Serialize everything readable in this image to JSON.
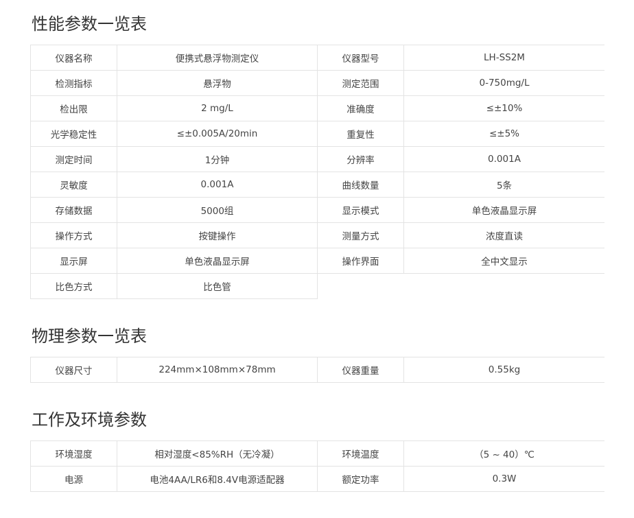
{
  "sections": [
    {
      "title": "性能参数一览表",
      "rows": [
        [
          "仪器名称",
          "便携式悬浮物测定仪",
          "仪器型号",
          "LH-SS2M"
        ],
        [
          "检测指标",
          "悬浮物",
          "测定范围",
          "0-750mg/L"
        ],
        [
          "检出限",
          "2 mg/L",
          "准确度",
          "≤±10%"
        ],
        [
          "光学稳定性",
          "≤±0.005A/20min",
          "重复性",
          "≤±5%"
        ],
        [
          "测定时间",
          "1分钟",
          "分辨率",
          "0.001A"
        ],
        [
          "灵敏度",
          "0.001A",
          "曲线数量",
          "5条"
        ],
        [
          "存储数据",
          "5000组",
          "显示模式",
          "单色液晶显示屏"
        ],
        [
          "操作方式",
          "按键操作",
          "测量方式",
          "浓度直读"
        ],
        [
          "显示屏",
          "单色液晶显示屏",
          "操作界面",
          "全中文显示"
        ],
        [
          "比色方式",
          "比色管"
        ]
      ]
    },
    {
      "title": "物理参数一览表",
      "rows": [
        [
          "仪器尺寸",
          "224mm×108mm×78mm",
          "仪器重量",
          "0.55kg"
        ]
      ]
    },
    {
      "title": "工作及环境参数",
      "rows": [
        [
          "环境湿度",
          "相对湿度<85%RH（无冷凝）",
          "环境温度",
          "（5 ~ 40）℃"
        ],
        [
          "电源",
          "电池4AA/LR6和8.4V电源适配器",
          "额定功率",
          "0.3W"
        ]
      ]
    }
  ]
}
